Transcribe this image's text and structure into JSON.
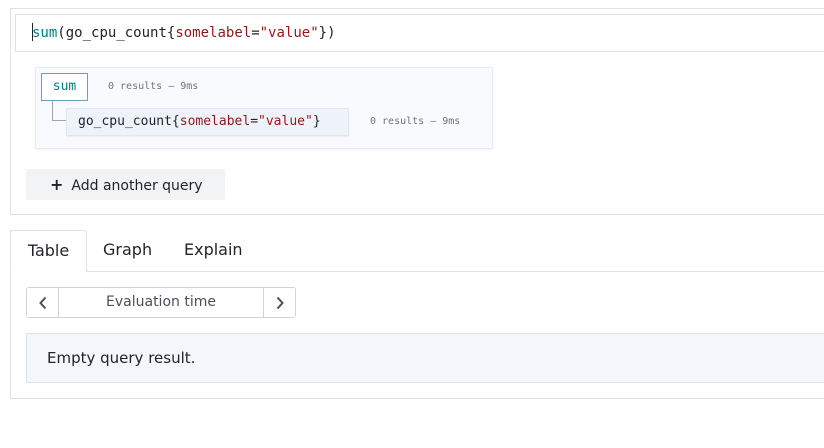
{
  "query": {
    "fn": "sum",
    "open_paren": "(",
    "metric": "go_cpu_count",
    "open_brace": "{",
    "label_name": "somelabel",
    "eq": "=",
    "label_value": "\"value\"",
    "close_brace": "}",
    "close_paren": ")"
  },
  "tree": {
    "root_label": "sum",
    "root_result": "0 results – 9ms",
    "child": {
      "metric": "go_cpu_count",
      "open_brace": "{",
      "label_name": "somelabel",
      "eq": "=",
      "label_value": "\"value\"",
      "close_brace": "}"
    },
    "child_result": "0 results – 9ms"
  },
  "add_query": {
    "icon": "plus-icon",
    "label": "Add another query"
  },
  "tabs": [
    {
      "label": "Table",
      "active": true
    },
    {
      "label": "Graph",
      "active": false
    },
    {
      "label": "Explain",
      "active": false
    }
  ],
  "eval": {
    "prev_icon": "chevron-left-icon",
    "next_icon": "chevron-right-icon",
    "placeholder": "Evaluation time"
  },
  "result_message": "Empty query result."
}
